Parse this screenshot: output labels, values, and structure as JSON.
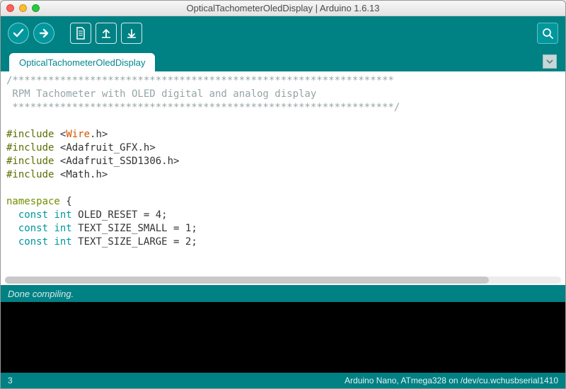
{
  "window": {
    "title": "OpticalTachometerOledDisplay | Arduino 1.6.13"
  },
  "tabs": {
    "active": "OpticalTachometerOledDisplay"
  },
  "code": {
    "line1": "/****************************************************************",
    "line2": " RPM Tachometer with OLED digital and analog display",
    "line3": " ****************************************************************/",
    "line4": "",
    "inc_kw": "#include",
    "inc1_a": "<",
    "inc1_b": "Wire",
    "inc1_c": ".h>",
    "inc2_a": "<",
    "inc2_b": "Adafruit_GFX",
    "inc2_c": ".h>",
    "inc3_a": "<",
    "inc3_b": "Adafruit_SSD1306",
    "inc3_c": ".h>",
    "inc4_a": "<",
    "inc4_b": "Math",
    "inc4_c": ".h>",
    "ns_kw": "namespace",
    "ns_brace": " {",
    "const_kw": "const",
    "int_kw": "int",
    "decl1": " OLED_RESET = 4;",
    "decl2": " TEXT_SIZE_SMALL = 1;",
    "decl3": " TEXT_SIZE_LARGE = 2;"
  },
  "status": {
    "message": "Done compiling."
  },
  "footer": {
    "line_number": "3",
    "board_port": "Arduino Nano, ATmega328 on /dev/cu.wchusbserial1410"
  }
}
